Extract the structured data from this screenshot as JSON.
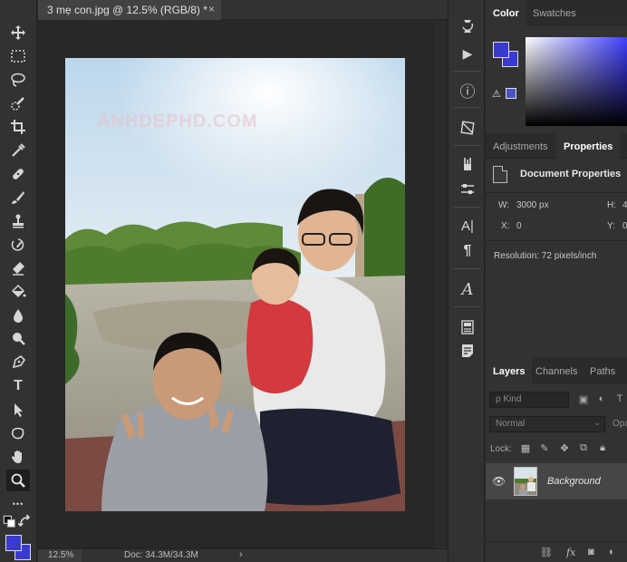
{
  "document": {
    "tab_title": "3 mẹ con.jpg @ 12.5% (RGB/8) *",
    "close_glyph": "×"
  },
  "status": {
    "zoom": "12.5%",
    "doc_size": "Doc: 34.3M/34.3M",
    "arrow": "›"
  },
  "toolbar": {
    "tools": [
      "move-icon",
      "marquee-icon",
      "lasso-icon",
      "quick-select-icon",
      "crop-icon",
      "eyedropper-icon",
      "healing-icon",
      "brush-icon",
      "stamp-icon",
      "history-brush-icon",
      "eraser-icon",
      "paint-bucket-icon",
      "blur-icon",
      "dodge-icon",
      "pen-icon",
      "type-icon",
      "path-select-icon",
      "shape-icon",
      "hand-icon",
      "zoom-icon",
      "more-icon"
    ],
    "type_glyph": "T",
    "more_glyph": "•••",
    "foreground_color": "#3a3ad1",
    "background_color": "#3a3ad1"
  },
  "dock": {
    "icons": [
      "history-icon",
      "actions-icon",
      "info-icon",
      "adjust-icon",
      "brush-settings-icon",
      "tool-presets-icon",
      "character-icon",
      "paragraph-icon",
      "glyphs-icon",
      "libraries-icon",
      "notes-icon"
    ],
    "character_glyph": "A|",
    "paragraph_glyph": "¶",
    "glyphs_glyph": "A",
    "info_glyph": "ⓘ",
    "play_glyph": "▶"
  },
  "color_panel": {
    "tabs": [
      "Color",
      "Swatches"
    ],
    "active_tab": "Color",
    "warning_glyph": "⚠",
    "swatch_color": "#4a53c2"
  },
  "properties_panel": {
    "tabs": [
      "Adjustments",
      "Properties"
    ],
    "active_tab": "Properties",
    "title": "Document Properties",
    "w_label": "W:",
    "w_value": "3000 px",
    "h_label": "H:",
    "h_value": "4",
    "x_label": "X:",
    "x_value": "0",
    "y_label": "Y:",
    "y_value": "0",
    "resolution": "Resolution: 72 pixels/inch"
  },
  "layers_panel": {
    "tabs": [
      "Layers",
      "Channels",
      "Paths"
    ],
    "active_tab": "Layers",
    "filter": "ρ Kind",
    "blend_mode": "Normal",
    "opacity_label": "Opa",
    "lock_label": "Lock:",
    "layer_name": "Background",
    "footer_fx": "fx"
  },
  "image": {
    "watermark": "ANHDEPHD.COM"
  }
}
